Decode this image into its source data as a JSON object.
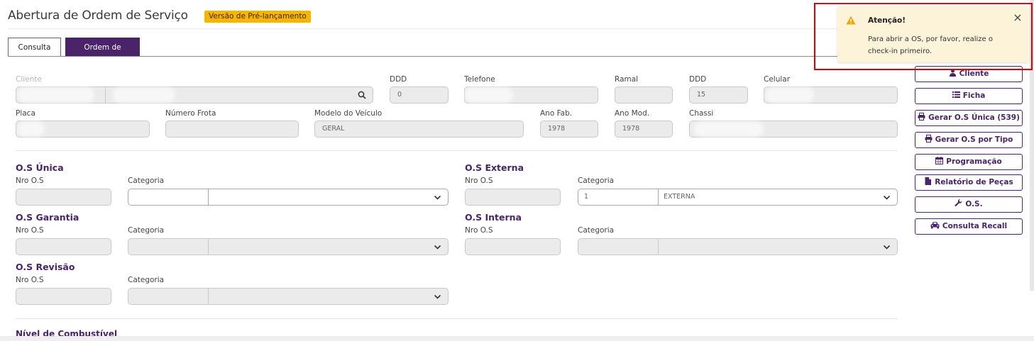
{
  "header": {
    "title": "Abertura de Ordem de Serviço",
    "badge": "Versão de Pré-lançamento"
  },
  "tabs": [
    {
      "label": "Consulta",
      "active": false
    },
    {
      "label": "Ordem de Serviço",
      "active": true
    }
  ],
  "client_row": {
    "cliente_label": "Cliente",
    "ddd1_label": "DDD",
    "ddd1_value": "0",
    "telefone_label": "Telefone",
    "ramal_label": "Ramal",
    "ddd2_label": "DDD",
    "ddd2_value": "15",
    "celular_label": "Celular"
  },
  "vehicle_row": {
    "placa_label": "Placa",
    "frota_label": "Número Frota",
    "modelo_label": "Modelo do Veículo",
    "modelo_value": "GERAL",
    "anofab_label": "Ano Fab.",
    "anofab_value": "1978",
    "anomod_label": "Ano Mod.",
    "anomod_value": "1978",
    "chassi_label": "Chassi"
  },
  "sections": {
    "unica": {
      "title": "O.S Única",
      "nro_label": "Nro O.S",
      "cat_label": "Categoria"
    },
    "externa": {
      "title": "O.S Externa",
      "nro_label": "Nro O.S",
      "cat_label": "Categoria",
      "cat_code": "1",
      "cat_name": "EXTERNA"
    },
    "garantia": {
      "title": "O.S Garantia",
      "nro_label": "Nro O.S",
      "cat_label": "Categoria"
    },
    "interna": {
      "title": "O.S Interna",
      "nro_label": "Nro O.S",
      "cat_label": "Categoria"
    },
    "revisao": {
      "title": "O.S Revisão",
      "nro_label": "Nro O.S",
      "cat_label": "Categoria"
    }
  },
  "fuel_label": "Nível de Combustível",
  "side_buttons": [
    {
      "label": "Cliente",
      "icon": "user-icon"
    },
    {
      "label": "Ficha",
      "icon": "list-icon"
    },
    {
      "label": "Gerar O.S Única (539)",
      "icon": "printer-icon"
    },
    {
      "label": "Gerar O.S por Tipo",
      "icon": "printer-icon"
    },
    {
      "label": "Programação",
      "icon": "calendar-icon"
    },
    {
      "label": "Relatório de Peças",
      "icon": "file-icon"
    },
    {
      "label": "O.S.",
      "icon": "wrench-icon"
    },
    {
      "label": "Consulta Recall",
      "icon": "car-icon"
    }
  ],
  "toast": {
    "title": "Atenção!",
    "message": "Para abrir a OS, por favor, realize o check-in primeiro."
  },
  "colors": {
    "brand": "#4a2368",
    "badge": "#f7b500",
    "toast_bg": "#fdf3d9",
    "highlight_frame": "#e00000",
    "warning": "#f0a500"
  }
}
